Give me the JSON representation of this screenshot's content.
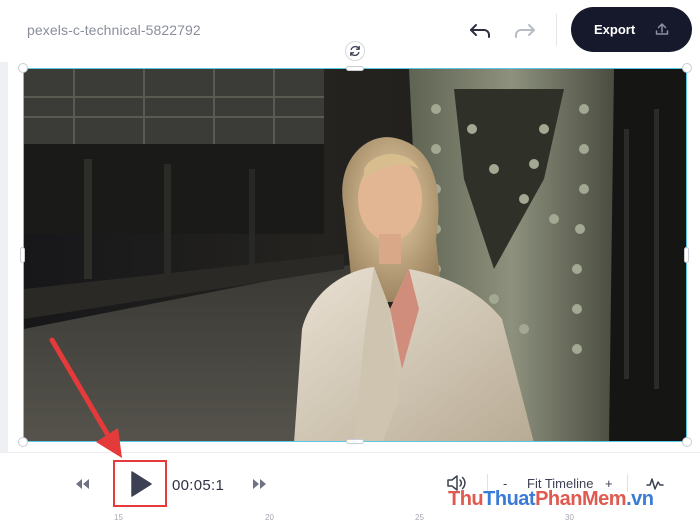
{
  "project": {
    "title": "pexels-c-technical-5822792"
  },
  "toolbar": {
    "export_label": "Export"
  },
  "player": {
    "time": "00:05:1"
  },
  "timeline": {
    "zoom_minus": "-",
    "zoom_label": "Fit Timeline",
    "zoom_plus": "+",
    "ruler_ticks": [
      "15",
      "20",
      "25",
      "30"
    ]
  },
  "watermark": {
    "part1": "Thu",
    "part2": "Thuat",
    "part3": "PhanMem",
    "part4": ".vn"
  },
  "colors": {
    "accent_selection": "#5bc8e6",
    "export_button": "#16192b",
    "annotation_red": "#e53a3a"
  }
}
